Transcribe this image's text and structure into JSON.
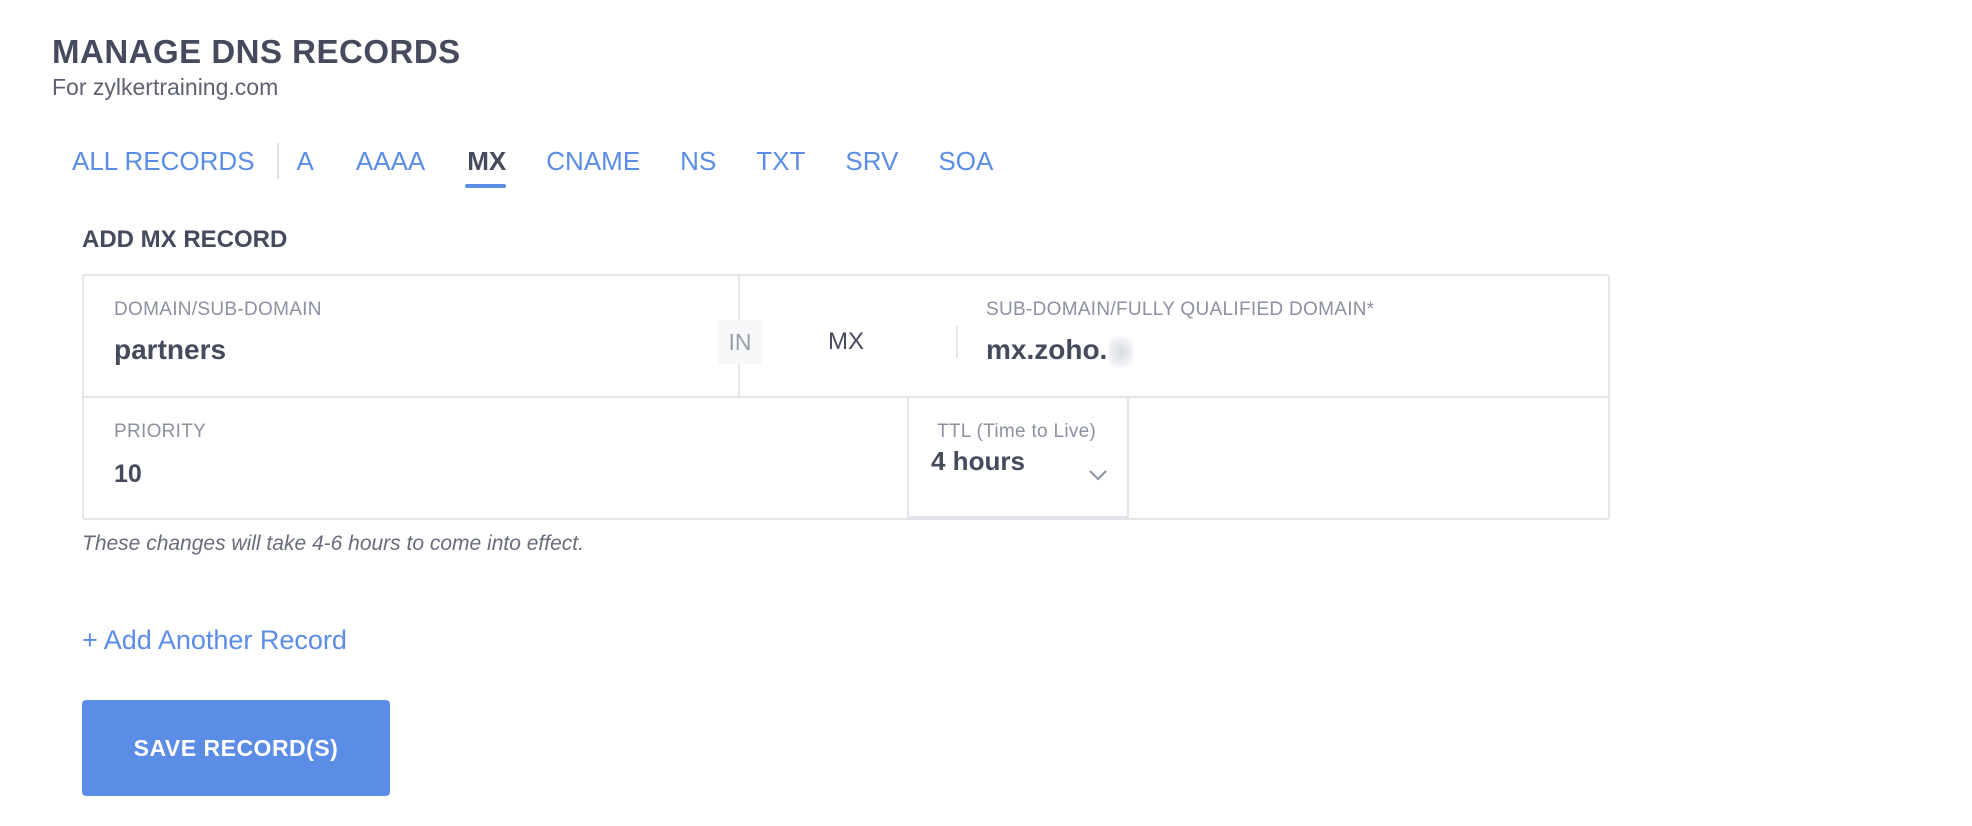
{
  "header": {
    "title": "MANAGE DNS RECORDS",
    "subtitle": "For zylkertraining.com"
  },
  "tabs": [
    {
      "label": "ALL RECORDS",
      "active": false
    },
    {
      "label": "A",
      "active": false
    },
    {
      "label": "AAAA",
      "active": false
    },
    {
      "label": "MX",
      "active": true
    },
    {
      "label": "CNAME",
      "active": false
    },
    {
      "label": "NS",
      "active": false
    },
    {
      "label": "TXT",
      "active": false
    },
    {
      "label": "SRV",
      "active": false
    },
    {
      "label": "SOA",
      "active": false
    }
  ],
  "form": {
    "heading": "ADD MX RECORD",
    "domain_label": "DOMAIN/SUB-DOMAIN",
    "domain_value": "partners",
    "class_chip": "IN",
    "record_type": "MX",
    "target_label": "SUB-DOMAIN/FULLY QUALIFIED DOMAIN*",
    "target_value": "mx.zoho.",
    "priority_label": "PRIORITY",
    "priority_value": "10",
    "ttl_label": "TTL (Time to Live)",
    "ttl_value": "4 hours",
    "note": "These changes will take 4-6 hours to come into effect."
  },
  "actions": {
    "add_another": "+ Add Another Record",
    "save": "SAVE RECORD(S)"
  },
  "colors": {
    "accent": "#5b8de6",
    "text_dark": "#454a5c",
    "text_muted": "#8c90a0",
    "border": "#e3e5ea"
  },
  "icons": {
    "ttl_dropdown": "chevron-down-icon"
  }
}
